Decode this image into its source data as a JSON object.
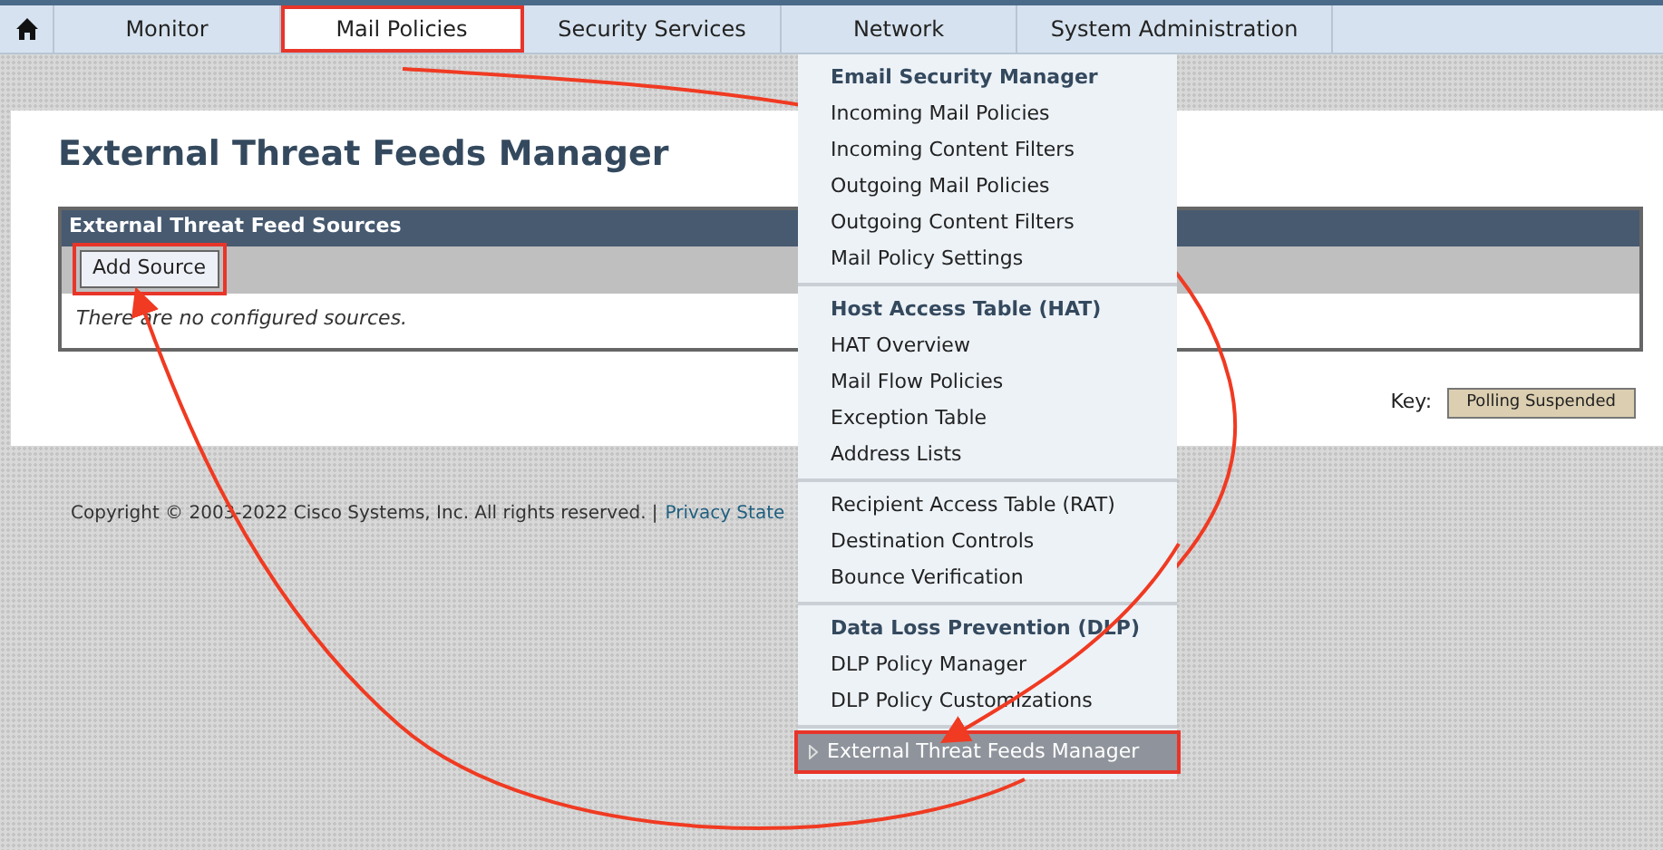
{
  "nav": {
    "tabs": [
      {
        "label": "Monitor",
        "selected": false,
        "highlighted": false
      },
      {
        "label": "Mail Policies",
        "selected": true,
        "highlighted": true
      },
      {
        "label": "Security Services",
        "selected": false,
        "highlighted": false
      },
      {
        "label": "Network",
        "selected": false,
        "highlighted": false
      },
      {
        "label": "System Administration",
        "selected": false,
        "highlighted": false
      }
    ]
  },
  "page": {
    "title": "External Threat Feeds Manager",
    "table": {
      "title": "External Threat Feed Sources",
      "add_button": {
        "label": "Add Source",
        "highlighted": true
      },
      "empty_message": "There are no configured sources."
    },
    "key": {
      "label": "Key:",
      "badge": "Polling Suspended"
    }
  },
  "footer": {
    "copyright": "Copyright © 2003-2022 Cisco Systems, Inc. All rights reserved. |",
    "link": "Privacy State"
  },
  "menu": {
    "sections": [
      {
        "heading": "Email Security Manager",
        "items": [
          {
            "label": "Incoming Mail Policies",
            "selected": false,
            "highlighted": false
          },
          {
            "label": "Incoming Content Filters",
            "selected": false,
            "highlighted": false
          },
          {
            "label": "Outgoing Mail Policies",
            "selected": false,
            "highlighted": false
          },
          {
            "label": "Outgoing Content Filters",
            "selected": false,
            "highlighted": false
          },
          {
            "label": "Mail Policy Settings",
            "selected": false,
            "highlighted": false
          }
        ]
      },
      {
        "heading": "Host Access Table (HAT)",
        "items": [
          {
            "label": "HAT Overview",
            "selected": false,
            "highlighted": false
          },
          {
            "label": "Mail Flow Policies",
            "selected": false,
            "highlighted": false
          },
          {
            "label": "Exception Table",
            "selected": false,
            "highlighted": false
          },
          {
            "label": "Address Lists",
            "selected": false,
            "highlighted": false
          }
        ]
      },
      {
        "items": [
          {
            "label": "Recipient Access Table (RAT)",
            "selected": false,
            "highlighted": false
          },
          {
            "label": "Destination Controls",
            "selected": false,
            "highlighted": false
          },
          {
            "label": "Bounce Verification",
            "selected": false,
            "highlighted": false
          }
        ]
      },
      {
        "heading": "Data Loss Prevention (DLP)",
        "items": [
          {
            "label": "DLP Policy Manager",
            "selected": false,
            "highlighted": false
          },
          {
            "label": "DLP Policy Customizations",
            "selected": false,
            "highlighted": false
          }
        ]
      },
      {
        "items": [
          {
            "label": "External Threat Feeds Manager",
            "selected": true,
            "highlighted": true
          }
        ]
      }
    ]
  }
}
